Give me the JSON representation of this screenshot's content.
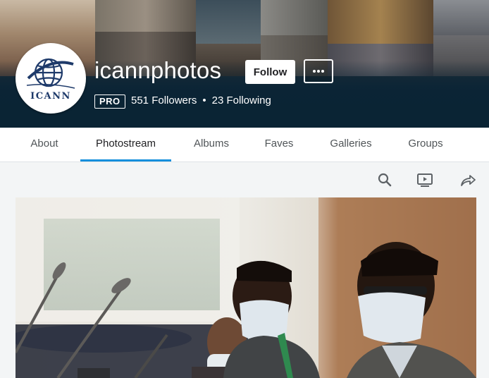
{
  "profile": {
    "username": "icannphotos",
    "avatar_text": "ICANN",
    "pro_label": "PRO",
    "followers": "551 Followers",
    "separator": "•",
    "following": "23 Following"
  },
  "actions": {
    "follow_label": "Follow",
    "more_label": "•••"
  },
  "tabs": [
    {
      "label": "About",
      "active": false
    },
    {
      "label": "Photostream",
      "active": true
    },
    {
      "label": "Albums",
      "active": false
    },
    {
      "label": "Faves",
      "active": false
    },
    {
      "label": "Galleries",
      "active": false
    },
    {
      "label": "Groups",
      "active": false
    }
  ],
  "toolbar": {
    "icons": [
      "search-icon",
      "slideshow-icon",
      "share-icon"
    ]
  },
  "colors": {
    "accent": "#128fdc",
    "header_dark": "#0a2434",
    "tab_text": "#505558"
  }
}
